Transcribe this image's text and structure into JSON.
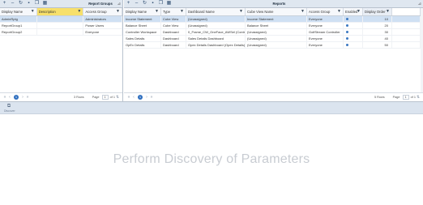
{
  "left_panel": {
    "title": "Report Groups",
    "columns": [
      "Display Name",
      "Description",
      "Access Group"
    ],
    "rows": [
      [
        "AdminRptg",
        "",
        "Administrators"
      ],
      [
        "ReportGroup1",
        "",
        "Power Users"
      ],
      [
        "ReportGroup2",
        "",
        "Everyone"
      ]
    ],
    "footer": {
      "rows_label": "3 Rows",
      "page_label": "Page",
      "page_value": "1",
      "of_label": "of 1",
      "current_page": "1"
    }
  },
  "right_panel": {
    "title": "Reports",
    "columns": [
      "Display Name",
      "Type",
      "Dashboard Name",
      "Cube View Name",
      "Access Group",
      "Enabled",
      "Display Order"
    ],
    "rows": [
      {
        "display_name": "Income Statement",
        "type": "Cube View",
        "dashboard": "(Unassigned)",
        "cube_view": "Income Statement",
        "access": "Everyone",
        "enabled": true,
        "order": "10"
      },
      {
        "display_name": "Balance Sheet",
        "type": "Cube View",
        "dashboard": "(Unassigned)",
        "cube_view": "Balance Sheet",
        "access": "Everyone",
        "enabled": true,
        "order": "20"
      },
      {
        "display_name": "Controller Workspace",
        "type": "Dashboard",
        "dashboard": "0_Frame_CW_OneFace_AWSel (Contr)",
        "cube_view": "(Unassigned)",
        "access": "GolfStream Controller",
        "enabled": true,
        "order": "30"
      },
      {
        "display_name": "Sales Details",
        "type": "Dashboard",
        "dashboard": "Sales Details Dashboard",
        "cube_view": "(Unassigned)",
        "access": "Everyone",
        "enabled": true,
        "order": "40"
      },
      {
        "display_name": "OpEx Details",
        "type": "Dashboard",
        "dashboard": "Opex Details Dashboard (Opex Details)",
        "cube_view": "(Unassigned)",
        "access": "Everyone",
        "enabled": true,
        "order": "50"
      }
    ],
    "footer": {
      "rows_label": "5 Rows",
      "page_label": "Page",
      "page_value": "1",
      "of_label": "of 1",
      "current_page": "1"
    }
  },
  "bottom_toolbar": {
    "discover_label": "Discover"
  },
  "message": "Perform Discovery of Parameters"
}
